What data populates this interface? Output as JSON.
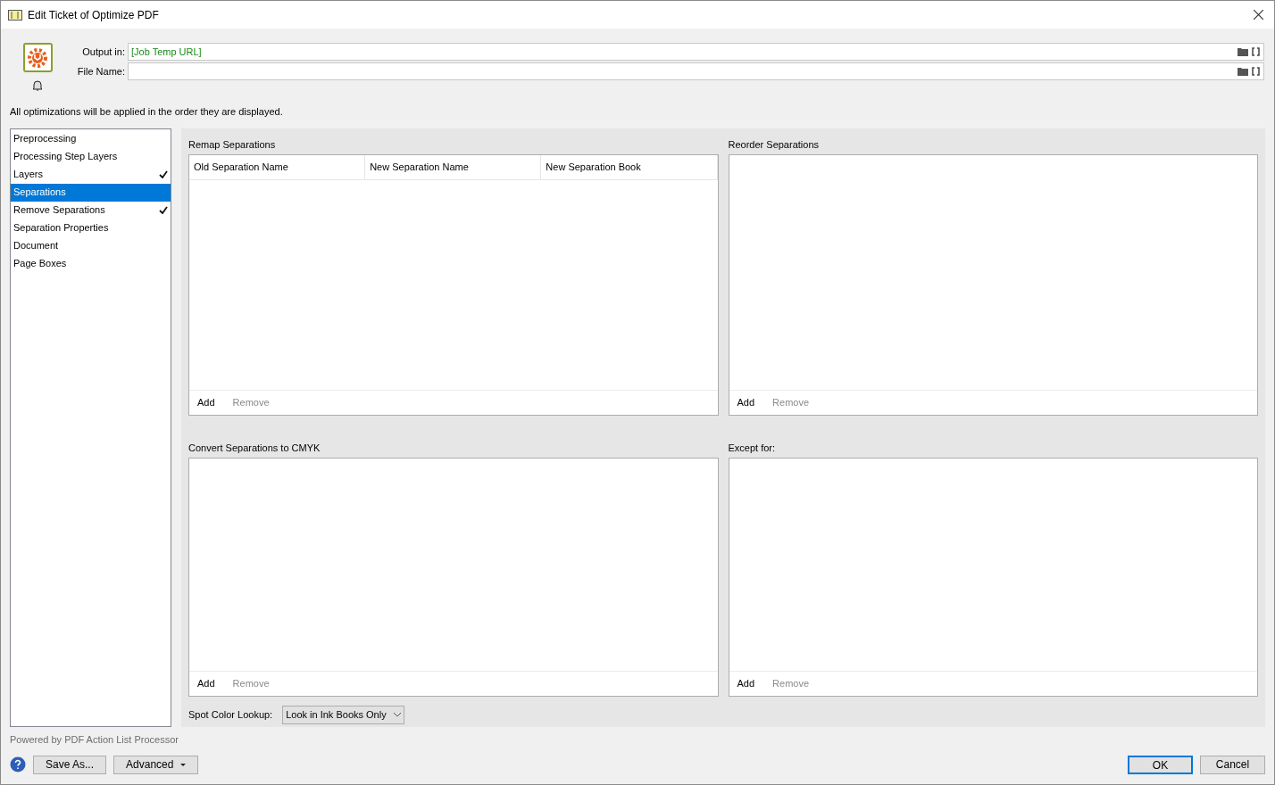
{
  "window": {
    "title": "Edit Ticket of Optimize PDF"
  },
  "header": {
    "output_in": {
      "label": "Output in:",
      "value": "[Job Temp URL]"
    },
    "file_name": {
      "label": "File Name:"
    },
    "notice": "All optimizations will be applied in the order they are displayed."
  },
  "sidebar": {
    "items": [
      {
        "label": "Preprocessing",
        "selected": false,
        "checked": false
      },
      {
        "label": "Processing Step Layers",
        "selected": false,
        "checked": false
      },
      {
        "label": "Layers",
        "selected": false,
        "checked": true
      },
      {
        "label": "Separations",
        "selected": true,
        "checked": false
      },
      {
        "label": "Remove Separations",
        "selected": false,
        "checked": true
      },
      {
        "label": "Separation Properties",
        "selected": false,
        "checked": false
      },
      {
        "label": "Document",
        "selected": false,
        "checked": false
      },
      {
        "label": "Page Boxes",
        "selected": false,
        "checked": false
      }
    ]
  },
  "panels": [
    {
      "title": "Remap Separations",
      "columns": [
        "Old Separation Name",
        "New Separation Name",
        "New Separation Book"
      ],
      "buttons": [
        {
          "label": "Add",
          "disabled": false
        },
        {
          "label": "Remove",
          "disabled": true
        }
      ]
    },
    {
      "title": "Reorder Separations",
      "buttons": [
        {
          "label": "Add",
          "disabled": false
        },
        {
          "label": "Remove",
          "disabled": true
        }
      ]
    },
    {
      "title": "Convert Separations to CMYK",
      "buttons": [
        {
          "label": "Add",
          "disabled": false
        },
        {
          "label": "Remove",
          "disabled": true
        }
      ]
    },
    {
      "title": "Except for:",
      "buttons": [
        {
          "label": "Add",
          "disabled": false
        },
        {
          "label": "Remove",
          "disabled": true
        }
      ]
    }
  ],
  "spot_color_lookup": {
    "label": "Spot Color Lookup:",
    "value": "Look in Ink Books Only"
  },
  "footer": {
    "powered_by": "Powered by PDF Action List Processor",
    "left_buttons": [
      {
        "label": "Save As...",
        "kind": "plain"
      },
      {
        "label": "Advanced",
        "kind": "menu"
      }
    ],
    "right_buttons": [
      {
        "label": "OK",
        "default": true
      },
      {
        "label": "Cancel",
        "default": false
      }
    ]
  }
}
